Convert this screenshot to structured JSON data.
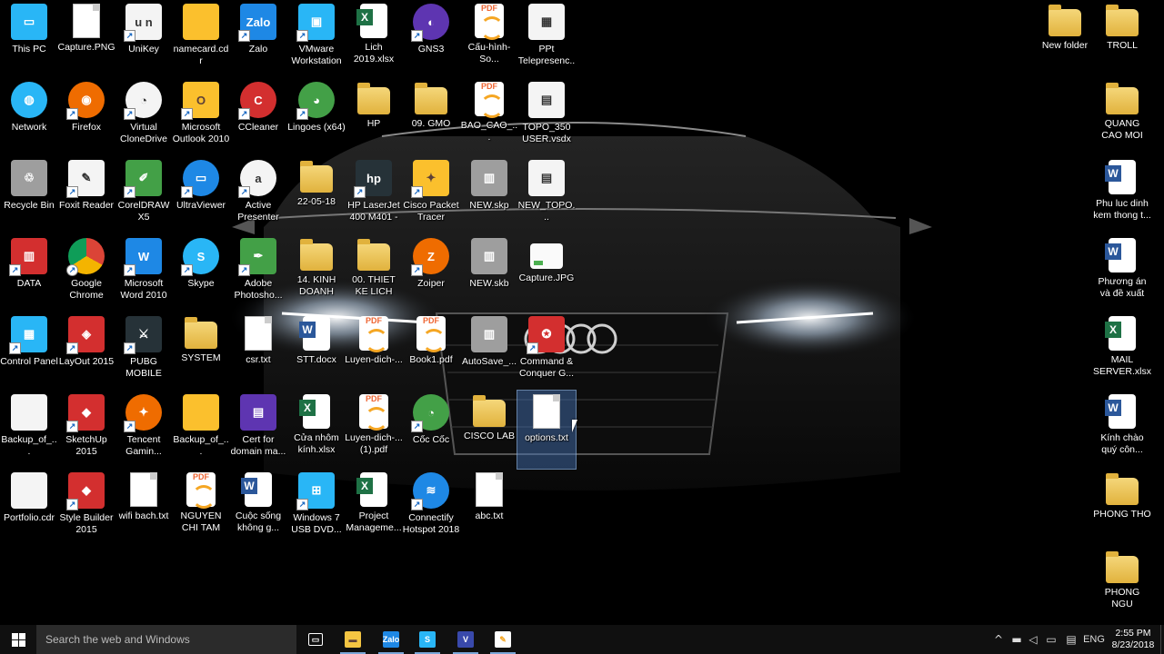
{
  "desktop": {
    "icons": [
      {
        "label": "This PC",
        "glyph": "pc-icon",
        "col": 0,
        "row": 0,
        "style": "g-sky",
        "text": "▭",
        "shortcut": false
      },
      {
        "label": "Capture.PNG",
        "glyph": "image-file-icon",
        "col": 1,
        "row": 0,
        "style": "g-doc",
        "text": "",
        "shortcut": false
      },
      {
        "label": "UniKey",
        "glyph": "unikey-icon",
        "col": 2,
        "row": 0,
        "style": "g-white",
        "text": "u n",
        "shortcut": true
      },
      {
        "label": "namecard.cdr",
        "glyph": "cdr-file-icon",
        "col": 3,
        "row": 0,
        "style": "g-yellow",
        "text": "",
        "shortcut": false
      },
      {
        "label": "Zalo",
        "glyph": "zalo-icon",
        "col": 4,
        "row": 0,
        "style": "g-blue",
        "text": "Zalo",
        "shortcut": true
      },
      {
        "label": "VMware Workstation",
        "glyph": "vmware-icon",
        "col": 5,
        "row": 0,
        "style": "g-sky",
        "text": "▣",
        "shortcut": true
      },
      {
        "label": "Lich 2019.xlsx",
        "glyph": "excel-file-icon",
        "col": 6,
        "row": 0,
        "style": "g-excel",
        "text": "",
        "shortcut": false
      },
      {
        "label": "GNS3",
        "glyph": "gns3-icon",
        "col": 7,
        "row": 0,
        "style": "g-purple g-round",
        "text": "◐",
        "shortcut": true
      },
      {
        "label": "Cấu-hình-So...",
        "glyph": "pdf-file-icon",
        "col": 8,
        "row": 0,
        "style": "g-pdf",
        "text": "PDF",
        "shortcut": false
      },
      {
        "label": "PPt Telepresenc...",
        "glyph": "ppt-icon",
        "col": 9,
        "row": 0,
        "style": "g-white",
        "text": "▦",
        "shortcut": false
      },
      {
        "label": "Network",
        "glyph": "network-icon",
        "col": 0,
        "row": 1,
        "style": "g-sky g-round",
        "text": "◍",
        "shortcut": false
      },
      {
        "label": "Firefox",
        "glyph": "firefox-icon",
        "col": 1,
        "row": 1,
        "style": "g-orange g-round",
        "text": "◉",
        "shortcut": true
      },
      {
        "label": "Virtual CloneDrive",
        "glyph": "sheep-icon",
        "col": 2,
        "row": 1,
        "style": "g-white g-round",
        "text": "◔",
        "shortcut": true
      },
      {
        "label": "Microsoft Outlook 2010",
        "glyph": "outlook-icon",
        "col": 3,
        "row": 1,
        "style": "g-yellow",
        "text": "O",
        "shortcut": true
      },
      {
        "label": "CCleaner",
        "glyph": "ccleaner-icon",
        "col": 4,
        "row": 1,
        "style": "g-red g-round",
        "text": "C",
        "shortcut": true
      },
      {
        "label": "Lingoes (x64)",
        "glyph": "lingoes-icon",
        "col": 5,
        "row": 1,
        "style": "g-green g-round",
        "text": "◕",
        "shortcut": true
      },
      {
        "label": "HP",
        "glyph": "folder-icon",
        "col": 6,
        "row": 1,
        "style": "g-folder",
        "text": "",
        "shortcut": false
      },
      {
        "label": "09. GMO",
        "glyph": "folder-icon",
        "col": 7,
        "row": 1,
        "style": "g-folder",
        "text": "",
        "shortcut": false
      },
      {
        "label": "BAO_CAO_...",
        "glyph": "pdf-file-icon",
        "col": 8,
        "row": 1,
        "style": "g-pdf",
        "text": "PDF",
        "shortcut": false
      },
      {
        "label": "TOPO_350 USER.vsdx",
        "glyph": "visio-file-icon",
        "col": 9,
        "row": 1,
        "style": "g-white",
        "text": "▤",
        "shortcut": false
      },
      {
        "label": "Recycle Bin",
        "glyph": "recycle-bin-icon",
        "col": 0,
        "row": 2,
        "style": "g-grey",
        "text": "♲",
        "shortcut": false
      },
      {
        "label": "Foxit Reader",
        "glyph": "foxit-icon",
        "col": 1,
        "row": 2,
        "style": "g-white",
        "text": "✎",
        "shortcut": true
      },
      {
        "label": "CorelDRAW X5",
        "glyph": "coreldraw-icon",
        "col": 2,
        "row": 2,
        "style": "g-green",
        "text": "✐",
        "shortcut": true
      },
      {
        "label": "UltraViewer",
        "glyph": "ultraviewer-icon",
        "col": 3,
        "row": 2,
        "style": "g-blue g-round",
        "text": "▭",
        "shortcut": true
      },
      {
        "label": "Active Presenter",
        "glyph": "activepresenter-icon",
        "col": 4,
        "row": 2,
        "style": "g-white g-round",
        "text": "a",
        "shortcut": true
      },
      {
        "label": "22-05-18",
        "glyph": "folder-icon",
        "col": 5,
        "row": 2,
        "style": "g-folder",
        "text": "",
        "shortcut": false
      },
      {
        "label": "HP LaserJet 400 M401 - ...",
        "glyph": "printer-icon",
        "col": 6,
        "row": 2,
        "style": "g-dark",
        "text": "hp",
        "shortcut": true
      },
      {
        "label": "Cisco Packet Tracer",
        "glyph": "packet-tracer-icon",
        "col": 7,
        "row": 2,
        "style": "g-yellow",
        "text": "✦",
        "shortcut": true
      },
      {
        "label": "NEW.skp",
        "glyph": "sketchup-file-icon",
        "col": 8,
        "row": 2,
        "style": "g-grey",
        "text": "▥",
        "shortcut": false
      },
      {
        "label": "NEW_TOPO...",
        "glyph": "visio-file-icon",
        "col": 9,
        "row": 2,
        "style": "g-white",
        "text": "▤",
        "shortcut": false
      },
      {
        "label": "DATA",
        "glyph": "data-icon",
        "col": 0,
        "row": 3,
        "style": "g-red",
        "text": "▥",
        "shortcut": true
      },
      {
        "label": "Google Chrome",
        "glyph": "chrome-icon",
        "col": 1,
        "row": 3,
        "style": "g-chrome",
        "text": "",
        "shortcut": true
      },
      {
        "label": "Microsoft Word 2010",
        "glyph": "word-icon",
        "col": 2,
        "row": 3,
        "style": "g-blue",
        "text": "W",
        "shortcut": true
      },
      {
        "label": "Skype",
        "glyph": "skype-icon",
        "col": 3,
        "row": 3,
        "style": "g-sky g-round",
        "text": "S",
        "shortcut": true
      },
      {
        "label": "Adobe Photosho...",
        "glyph": "photoshop-feather-icon",
        "col": 4,
        "row": 3,
        "style": "g-green",
        "text": "✒",
        "shortcut": true
      },
      {
        "label": "14. KINH DOANH",
        "glyph": "folder-icon",
        "col": 5,
        "row": 3,
        "style": "g-folder",
        "text": "",
        "shortcut": false
      },
      {
        "label": "00. THIET KE LICH",
        "glyph": "folder-icon",
        "col": 6,
        "row": 3,
        "style": "g-folder",
        "text": "",
        "shortcut": false
      },
      {
        "label": "Zoiper",
        "glyph": "zoiper-icon",
        "col": 7,
        "row": 3,
        "style": "g-orange g-round",
        "text": "Z",
        "shortcut": true
      },
      {
        "label": "NEW.skb",
        "glyph": "sketchup-file-icon",
        "col": 8,
        "row": 3,
        "style": "g-grey",
        "text": "▥",
        "shortcut": false
      },
      {
        "label": "Capture.JPG",
        "glyph": "image-file-icon",
        "col": 9,
        "row": 3,
        "style": "g-img",
        "text": "",
        "shortcut": false
      },
      {
        "label": "Control Panel",
        "glyph": "control-panel-icon",
        "col": 0,
        "row": 4,
        "style": "g-sky",
        "text": "▦",
        "shortcut": true
      },
      {
        "label": "LayOut 2015",
        "glyph": "layout-icon",
        "col": 1,
        "row": 4,
        "style": "g-red",
        "text": "◈",
        "shortcut": true
      },
      {
        "label": "PUBG MOBILE",
        "glyph": "pubg-icon",
        "col": 2,
        "row": 4,
        "style": "g-dark",
        "text": "⚔",
        "shortcut": true
      },
      {
        "label": "SYSTEM",
        "glyph": "folder-icon",
        "col": 3,
        "row": 4,
        "style": "g-folder",
        "text": "",
        "shortcut": false
      },
      {
        "label": "csr.txt",
        "glyph": "text-file-icon",
        "col": 4,
        "row": 4,
        "style": "g-doc",
        "text": "",
        "shortcut": false
      },
      {
        "label": "STT.docx",
        "glyph": "word-file-icon",
        "col": 5,
        "row": 4,
        "style": "g-word",
        "text": "",
        "shortcut": false
      },
      {
        "label": "Luyen-dich-...",
        "glyph": "pdf-file-icon",
        "col": 6,
        "row": 4,
        "style": "g-pdf",
        "text": "PDF",
        "shortcut": false
      },
      {
        "label": "Book1.pdf",
        "glyph": "pdf-file-icon",
        "col": 7,
        "row": 4,
        "style": "g-pdf",
        "text": "PDF",
        "shortcut": false
      },
      {
        "label": "AutoSave_...",
        "glyph": "sketchup-file-icon",
        "col": 8,
        "row": 4,
        "style": "g-grey",
        "text": "▥",
        "shortcut": false
      },
      {
        "label": "Command & Conquer G...",
        "glyph": "command-conquer-icon",
        "col": 9,
        "row": 4,
        "style": "g-red",
        "text": "✪",
        "shortcut": true
      },
      {
        "label": "Backup_of_...",
        "glyph": "cdr-file-icon",
        "col": 0,
        "row": 5,
        "style": "g-white",
        "text": "",
        "shortcut": false
      },
      {
        "label": "SketchUp 2015",
        "glyph": "sketchup-icon",
        "col": 1,
        "row": 5,
        "style": "g-red",
        "text": "◆",
        "shortcut": true
      },
      {
        "label": "Tencent Gamin...",
        "glyph": "tencent-icon",
        "col": 2,
        "row": 5,
        "style": "g-orange g-round",
        "text": "✦",
        "shortcut": true
      },
      {
        "label": "Backup_of_...",
        "glyph": "cdr-file-icon",
        "col": 3,
        "row": 5,
        "style": "g-yellow",
        "text": "",
        "shortcut": false
      },
      {
        "label": "Cert for domain ma...",
        "glyph": "winrar-icon",
        "col": 4,
        "row": 5,
        "style": "g-purple",
        "text": "▤",
        "shortcut": false
      },
      {
        "label": "Cửa nhôm kính.xlsx",
        "glyph": "excel-file-icon",
        "col": 5,
        "row": 5,
        "style": "g-excel",
        "text": "",
        "shortcut": false
      },
      {
        "label": "Luyen-dich-... (1).pdf",
        "glyph": "pdf-file-icon",
        "col": 6,
        "row": 5,
        "style": "g-pdf",
        "text": "PDF",
        "shortcut": false
      },
      {
        "label": "Cốc Cốc",
        "glyph": "coccoc-icon",
        "col": 7,
        "row": 5,
        "style": "g-green g-round",
        "text": "◔",
        "shortcut": true
      },
      {
        "label": "CISCO LAB",
        "glyph": "folder-icon",
        "col": 8,
        "row": 5,
        "style": "g-folder",
        "text": "",
        "shortcut": false
      },
      {
        "label": "options.txt",
        "glyph": "text-file-icon",
        "col": 9,
        "row": 5,
        "style": "g-doc",
        "text": "",
        "shortcut": false,
        "selected": true
      },
      {
        "label": "Portfolio.cdr",
        "glyph": "cdr-file-icon",
        "col": 0,
        "row": 6,
        "style": "g-white",
        "text": "",
        "shortcut": false
      },
      {
        "label": "Style Builder 2015",
        "glyph": "style-builder-icon",
        "col": 1,
        "row": 6,
        "style": "g-red",
        "text": "◆",
        "shortcut": true
      },
      {
        "label": "wifi bach.txt",
        "glyph": "text-file-icon",
        "col": 2,
        "row": 6,
        "style": "g-doc",
        "text": "",
        "shortcut": false
      },
      {
        "label": "NGUYEN CHI TAM _CV.pdf",
        "glyph": "pdf-file-icon",
        "col": 3,
        "row": 6,
        "style": "g-pdf",
        "text": "PDF",
        "shortcut": false
      },
      {
        "label": "Cuộc sống không g...",
        "glyph": "word-file-icon",
        "col": 4,
        "row": 6,
        "style": "g-word",
        "text": "",
        "shortcut": false
      },
      {
        "label": "Windows 7 USB DVD...",
        "glyph": "windows-usb-icon",
        "col": 5,
        "row": 6,
        "style": "g-sky",
        "text": "⊞",
        "shortcut": true
      },
      {
        "label": "Project Manageme...",
        "glyph": "excel-file-icon",
        "col": 6,
        "row": 6,
        "style": "g-excel",
        "text": "",
        "shortcut": false
      },
      {
        "label": "Connectify Hotspot 2018",
        "glyph": "connectify-icon",
        "col": 7,
        "row": 6,
        "style": "g-blue g-round",
        "text": "≋",
        "shortcut": true
      },
      {
        "label": "abc.txt",
        "glyph": "text-file-icon",
        "col": 8,
        "row": 6,
        "style": "g-doc",
        "text": "",
        "shortcut": false
      },
      {
        "label": "New folder",
        "glyph": "folder-icon",
        "col": "r1",
        "row": 0,
        "style": "g-folder",
        "text": "",
        "shortcut": false
      },
      {
        "label": "TROLL",
        "glyph": "troll-folder-icon",
        "col": "r2",
        "row": 0,
        "style": "g-folder",
        "text": "",
        "shortcut": false
      },
      {
        "label": "QUANG CAO MOI",
        "glyph": "folder-icon",
        "col": "r2",
        "row": 1,
        "style": "g-folder",
        "text": "",
        "shortcut": false
      },
      {
        "label": "Phu luc dinh kem thong t...",
        "glyph": "word-file-icon",
        "col": "r2",
        "row": 2,
        "style": "g-word",
        "text": "",
        "shortcut": false
      },
      {
        "label": "Phương án và đề xuất  cho...",
        "glyph": "word-file-icon",
        "col": "r2",
        "row": 3,
        "style": "g-word",
        "text": "",
        "shortcut": false
      },
      {
        "label": "MAIL SERVER.xlsx",
        "glyph": "excel-file-icon",
        "col": "r2",
        "row": 4,
        "style": "g-excel",
        "text": "",
        "shortcut": false
      },
      {
        "label": "Kính chào quý côn...",
        "glyph": "word-file-icon",
        "col": "r2",
        "row": 5,
        "style": "g-word",
        "text": "",
        "shortcut": false
      },
      {
        "label": "PHONG THO",
        "glyph": "folder-icon",
        "col": "r2",
        "row": 6,
        "style": "g-folder",
        "text": "",
        "shortcut": false
      },
      {
        "label": "PHONG NGU",
        "glyph": "folder-icon",
        "col": "r2",
        "row": 7,
        "style": "g-folder",
        "text": "",
        "shortcut": false
      }
    ]
  },
  "taskbar": {
    "search_placeholder": "Search the web and Windows",
    "apps": [
      {
        "name": "task-view-button",
        "text": "▭",
        "bg": "transparent",
        "color": "#ffffff",
        "active": false
      },
      {
        "name": "file-explorer-button",
        "text": "▬",
        "bg": "#f4c542",
        "color": "#5d4037",
        "active": true
      },
      {
        "name": "zalo-taskbar-button",
        "text": "Zalo",
        "bg": "#1e88e5",
        "color": "#ffffff",
        "active": true
      },
      {
        "name": "skype-taskbar-button",
        "text": "S",
        "bg": "#29b6f6",
        "color": "#ffffff",
        "active": true
      },
      {
        "name": "visio-taskbar-button",
        "text": "V",
        "bg": "#3949ab",
        "color": "#ffffff",
        "active": true
      },
      {
        "name": "foxit-taskbar-button",
        "text": "✎",
        "bg": "#ffffff",
        "color": "#f5a623",
        "active": true
      }
    ],
    "tray": {
      "chevron": "^",
      "language": "ENG",
      "time": "2:55 PM",
      "date": "8/23/2018"
    }
  }
}
